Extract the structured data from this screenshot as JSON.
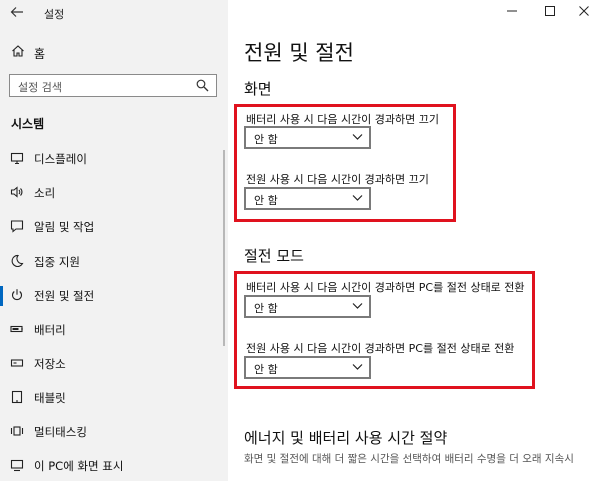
{
  "window": {
    "title": "설정",
    "controls": [
      "minimize-icon",
      "maximize-icon",
      "close-icon"
    ]
  },
  "sidebar": {
    "home_label": "홈",
    "search_placeholder": "설정 검색",
    "section_title": "시스템",
    "items": [
      {
        "label": "디스플레이",
        "icon": "display-icon"
      },
      {
        "label": "소리",
        "icon": "sound-icon"
      },
      {
        "label": "알림 및 작업",
        "icon": "notification-icon"
      },
      {
        "label": "집중 지원",
        "icon": "moon-icon"
      },
      {
        "label": "전원 및 절전",
        "icon": "power-icon",
        "selected": true
      },
      {
        "label": "배터리",
        "icon": "battery-icon"
      },
      {
        "label": "저장소",
        "icon": "storage-icon"
      },
      {
        "label": "태블릿",
        "icon": "tablet-icon"
      },
      {
        "label": "멀티태스킹",
        "icon": "multitasking-icon"
      },
      {
        "label": "이 PC에 화면 표시",
        "icon": "project-icon"
      }
    ]
  },
  "main": {
    "title": "전원 및 절전",
    "screen": {
      "title": "화면",
      "battery_label": "배터리 사용 시 다음 시간이 경과하면 끄기",
      "battery_value": "안 함",
      "plugged_label": "전원 사용 시 다음 시간이 경과하면 끄기",
      "plugged_value": "안 함"
    },
    "sleep": {
      "title": "절전 모드",
      "battery_label": "배터리 사용 시 다음 시간이 경과하면 PC를 절전 상태로 전환",
      "battery_value": "안 함",
      "plugged_label": "전원 사용 시 다음 시간이 경과하면 PC를 절전 상태로 전환",
      "plugged_value": "안 함"
    },
    "energy": {
      "title": "에너지 및 배터리 사용 시간 절약",
      "description": "화면 및 절전에 대해 더 짧은 시간을 선택하여 배터리 수명을 더 오래 지속시"
    }
  },
  "colors": {
    "accent": "#0067c0",
    "highlight": "#e0121e"
  }
}
